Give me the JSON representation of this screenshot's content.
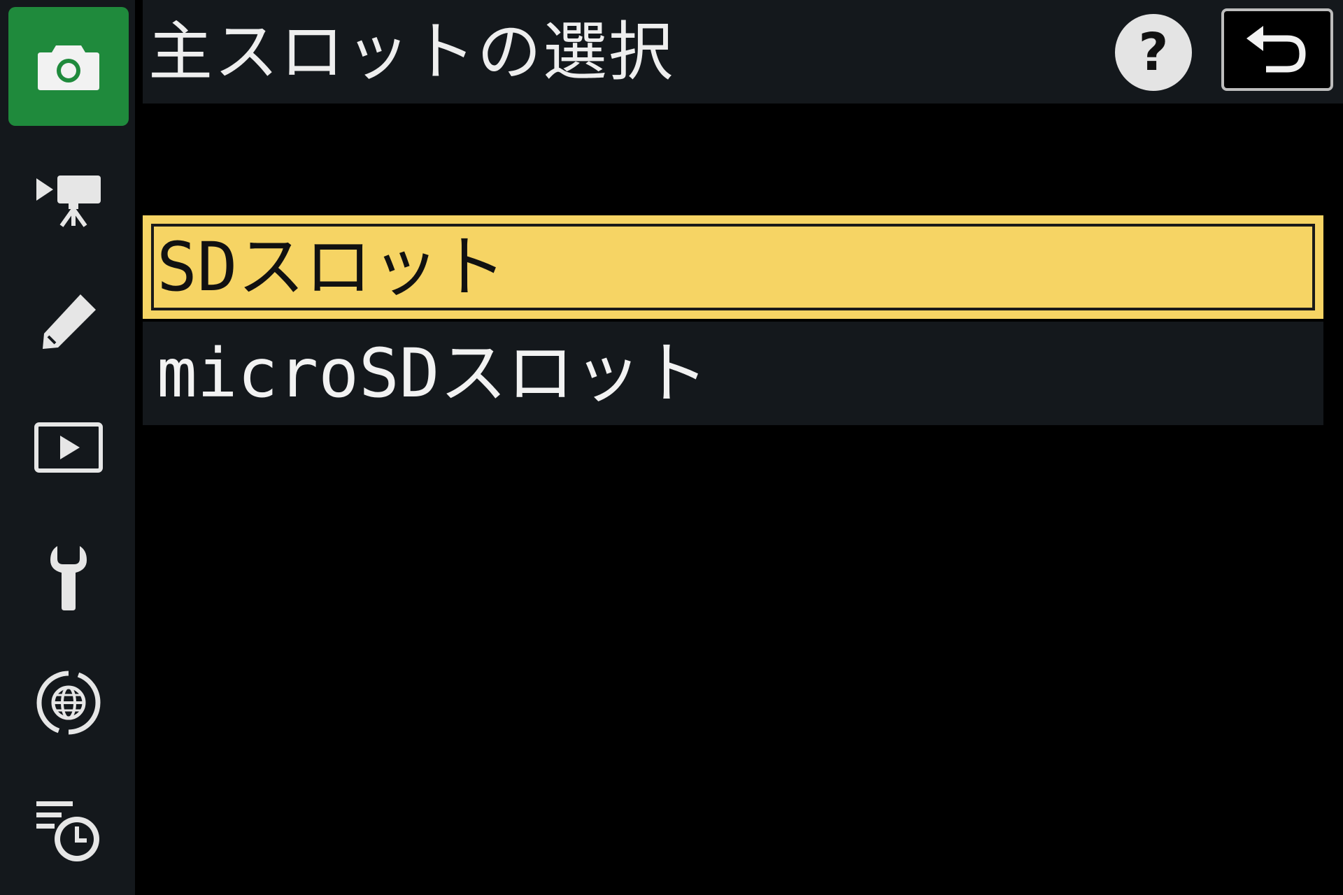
{
  "header": {
    "title": "主スロットの選択",
    "help_label": "?"
  },
  "sidebar": {
    "items": [
      {
        "icon": "camera-icon",
        "active": true
      },
      {
        "icon": "movie-camera-icon",
        "active": false
      },
      {
        "icon": "pencil-icon",
        "active": false
      },
      {
        "icon": "playback-icon",
        "active": false
      },
      {
        "icon": "wrench-icon",
        "active": false
      },
      {
        "icon": "network-icon",
        "active": false
      },
      {
        "icon": "recent-settings-icon",
        "active": false
      }
    ]
  },
  "menu": {
    "options": [
      {
        "label": "SDスロット",
        "selected": true
      },
      {
        "label": "microSDスロット",
        "selected": false
      }
    ]
  },
  "colors": {
    "sidebar_bg": "#14181c",
    "active_tab": "#1f8a3c",
    "highlight": "#f6d464"
  }
}
